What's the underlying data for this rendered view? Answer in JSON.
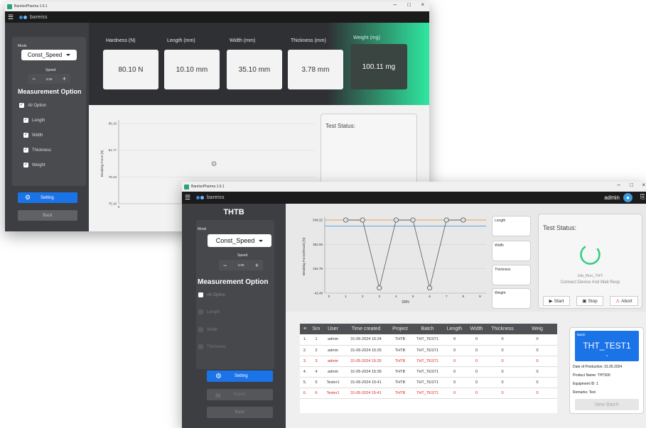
{
  "back_window": {
    "title": "BarelssPharma 1.6.1",
    "logo": "bareiss",
    "mode_label": "Mode",
    "mode_value": "Const_Speed",
    "speed_label": "Speed",
    "speed_value": "3.00",
    "measurement_title": "Measurement Option",
    "options": [
      "All Option",
      "Length",
      "Width",
      "Thickness",
      "Weight"
    ],
    "setting_label": "Setting",
    "back_label": "Back",
    "metrics": [
      {
        "label": "Hardness (N)",
        "value": "80.10 N"
      },
      {
        "label": "Length (mm)",
        "value": "10.10 mm"
      },
      {
        "label": "Width (mm)",
        "value": "35.10 mm"
      },
      {
        "label": "Thickness (mm)",
        "value": "3.78 mm"
      },
      {
        "label": "Weight (mg)",
        "value": "100.11 mg"
      }
    ],
    "chart_ylabel": "Breaking Force [N]",
    "chart_yticks": [
      "85.10",
      "81.77",
      "78.43",
      "75.10"
    ],
    "chart_x0": "0",
    "test_status_label": "Test Status:"
  },
  "front_window": {
    "title": "BarelssPharma 1.6.1",
    "logo": "bareiss",
    "user": "admin",
    "product_code": "THTB",
    "mode_label": "Mode",
    "mode_value": "Const_Speed",
    "speed_label": "Speed",
    "speed_value": "3.00",
    "measurement_title": "Measurement Option",
    "options": [
      "All Option",
      "Length",
      "Width",
      "Thickness"
    ],
    "setting_label": "Setting",
    "export_label": "Export",
    "back_label": "Back",
    "chart_ylabel": "Breaking Force(Result) [N]",
    "chart_xlabel": "SRN",
    "side_fields": [
      "Length",
      "Width",
      "Thickness",
      "Weight"
    ],
    "test_status_label": "Test Status:",
    "status_job": "Job_Run_THT:",
    "status_msg": "Connect Device And Wait Resp",
    "start_label": "Start",
    "stop_label": "Stop",
    "abort_label": "Abort",
    "table_headers": [
      "Srn",
      "User",
      "Time created",
      "Project",
      "Batch",
      "Length",
      "Width",
      "Thickness",
      "Weig"
    ],
    "rows": [
      {
        "idx": "1.",
        "srn": "1",
        "user": "admin",
        "time": "31-05-2024 15:24",
        "project": "THTB",
        "batch": "THT_TEST1",
        "length": "0",
        "width": "0",
        "thickness": "0",
        "weight": "0",
        "error": false
      },
      {
        "idx": "2.",
        "srn": "2",
        "user": "admin",
        "time": "31-05-2024 15:25",
        "project": "THTB",
        "batch": "THT_TEST1",
        "length": "0",
        "width": "0",
        "thickness": "0",
        "weight": "0",
        "error": false
      },
      {
        "idx": "3.",
        "srn": "3",
        "user": "admin",
        "time": "31-05-2024 15:25",
        "project": "THTB",
        "batch": "THT_TEST1",
        "length": "0",
        "width": "0",
        "thickness": "0",
        "weight": "0",
        "error": true
      },
      {
        "idx": "4.",
        "srn": "4",
        "user": "admin",
        "time": "31-05-2024 15:39",
        "project": "THTB",
        "batch": "THT_TEST1",
        "length": "0",
        "width": "0",
        "thickness": "0",
        "weight": "0",
        "error": false
      },
      {
        "idx": "5.",
        "srn": "5",
        "user": "Tester1",
        "time": "31-05-2024 15:41",
        "project": "THTB",
        "batch": "THT_TEST1",
        "length": "0",
        "width": "0",
        "thickness": "0",
        "weight": "0",
        "error": false
      },
      {
        "idx": "6.",
        "srn": "6",
        "user": "Tester1",
        "time": "31-05-2024 15:41",
        "project": "THTB",
        "batch": "THT_TEST1",
        "length": "0",
        "width": "0",
        "thickness": "0",
        "weight": "0",
        "error": true
      }
    ],
    "batch_label": "Batch",
    "batch_value": "THT_TEST1",
    "batch_info": [
      "Date of Production: 31.05.2024",
      "Product Name: THT500",
      "Equipment ID: 1",
      "Remarks: Test"
    ],
    "new_batch_label": "New Batch"
  },
  "chart_data": [
    {
      "type": "scatter",
      "ylabel": "Breaking Force [N]",
      "ylim": [
        75.1,
        85.1
      ],
      "yticks": [
        75.1,
        78.43,
        81.77,
        85.1
      ],
      "x": [
        3
      ],
      "y": [
        80.1
      ]
    },
    {
      "type": "line",
      "xlabel": "SRN",
      "ylabel": "Breaking Force(Result) [N]",
      "ylim": [
        -42.48,
        549.32
      ],
      "yticks": [
        -42.48,
        154.78,
        352.05,
        549.32
      ],
      "x": [
        1,
        2,
        3,
        4,
        5,
        6,
        7,
        8
      ],
      "y": [
        549.32,
        549.32,
        0,
        549.32,
        549.32,
        0,
        549.32,
        549.32
      ],
      "reference_lines": [
        {
          "color": "#e58a2a",
          "y": 549.32
        },
        {
          "color": "#4a9de0",
          "y": 500
        }
      ],
      "xticks": [
        0,
        1,
        2,
        3,
        4,
        5,
        6,
        7,
        8,
        9
      ],
      "grid": true
    }
  ],
  "colors": {
    "accent_blue": "#1b73e8",
    "error_red": "#e02020",
    "highlight_green": "#2ee8a0",
    "spinner_green": "#2fce80"
  }
}
